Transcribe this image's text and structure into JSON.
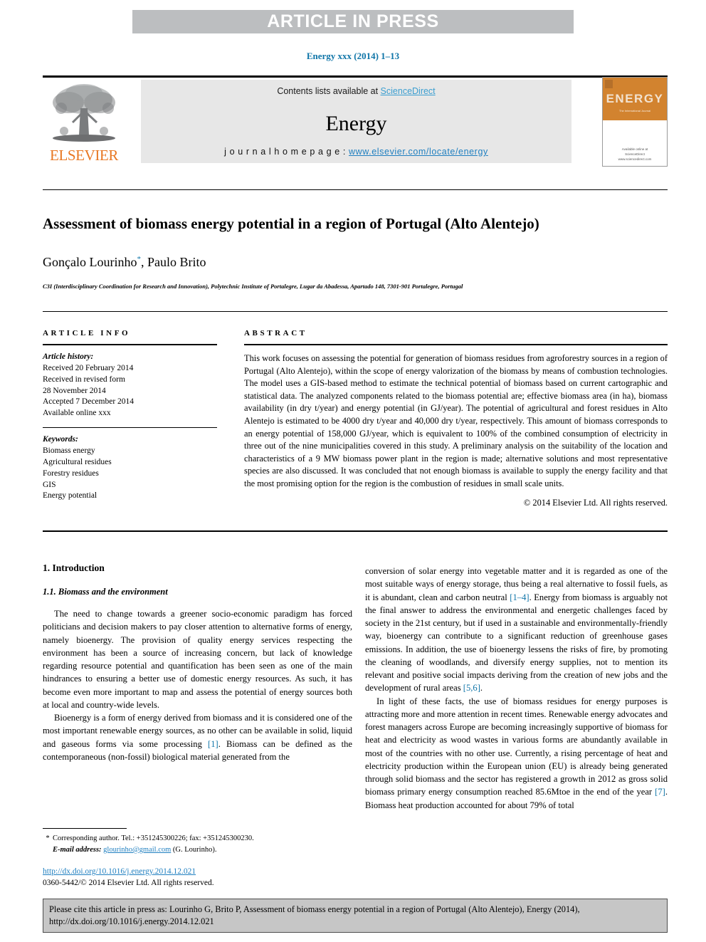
{
  "banner": {
    "text": "ARTICLE IN PRESS"
  },
  "running_head": {
    "text": "Energy xxx (2014) 1–13"
  },
  "masthead": {
    "contents_prefix": "Contents lists available at ",
    "sciencedirect": "ScienceDirect",
    "journal_title": "Energy",
    "homepage_prefix": "j o u r n a l   h o m e p a g e :  ",
    "homepage_url": "www.elsevier.com/locate/energy",
    "publisher": "ELSEVIER",
    "cover": {
      "title": "ENERGY",
      "subtitle": "The International Journal",
      "footer_line1": "Available online at",
      "footer_line2": "ScienceDirect",
      "footer_line3": "www.sciencedirect.com"
    }
  },
  "article": {
    "title": "Assessment of biomass energy potential in a region of Portugal (Alto Alentejo)",
    "authors": "Gonçalo Lourinho",
    "authors_rest": ", Paulo Brito",
    "corresponding_marker": "*",
    "affiliation": "C3I (Interdisciplinary Coordination for Research and Innovation), Polytechnic Institute of Portalegre, Lugar da Abadessa, Apartado 148, 7301-901 Portalegre, Portugal"
  },
  "article_info": {
    "heading": "ARTICLE INFO",
    "history_label": "Article history:",
    "history": [
      "Received 20 February 2014",
      "Received in revised form",
      "28 November 2014",
      "Accepted 7 December 2014",
      "Available online xxx"
    ],
    "keywords_label": "Keywords:",
    "keywords": [
      "Biomass energy",
      "Agricultural residues",
      "Forestry residues",
      "GIS",
      "Energy potential"
    ]
  },
  "abstract": {
    "heading": "ABSTRACT",
    "text": "This work focuses on assessing the potential for generation of biomass residues from agroforestry sources in a region of Portugal (Alto Alentejo), within the scope of energy valorization of the biomass by means of combustion technologies. The model uses a GIS-based method to estimate the technical potential of biomass based on current cartographic and statistical data. The analyzed components related to the biomass potential are; effective biomass area (in ha), biomass availability (in dry t/year) and energy potential (in GJ/year). The potential of agricultural and forest residues in Alto Alentejo is estimated to be 4000 dry t/year and 40,000 dry t/year, respectively. This amount of biomass corresponds to an energy potential of 158,000 GJ/year, which is equivalent to 100% of the combined consumption of electricity in three out of the nine municipalities covered in this study. A preliminary analysis on the suitability of the location and characteristics of a 9 MW biomass power plant in the region is made; alternative solutions and most representative species are also discussed. It was concluded that not enough biomass is available to supply the energy facility and that the most promising option for the region is the combustion of residues in small scale units.",
    "copyright": "© 2014 Elsevier Ltd. All rights reserved."
  },
  "body": {
    "section_number_title": "1. Introduction",
    "subsection_number_title": "1.1. Biomass and the environment",
    "left_paragraphs": [
      "The need to change towards a greener socio-economic paradigm has forced politicians and decision makers to pay closer attention to alternative forms of energy, namely bioenergy. The provision of quality energy services respecting the environment has been a source of increasing concern, but lack of knowledge regarding resource potential and quantification has been seen as one of the main hindrances to ensuring a better use of domestic energy resources. As such, it has become even more important to map and assess the potential of energy sources both at local and country-wide levels."
    ],
    "left_para2_a": "Bioenergy is a form of energy derived from biomass and it is considered one of the most important renewable energy sources, as no other can be available in solid, liquid and gaseous forms via some processing ",
    "left_para2_ref": "[1]",
    "left_para2_b": ". Biomass can be defined as the contemporaneous (non-fossil) biological material generated from the",
    "right_para1_a": "conversion of solar energy into vegetable matter and it is regarded as one of the most suitable ways of energy storage, thus being a real alternative to fossil fuels, as it is abundant, clean and carbon neutral ",
    "right_para1_ref": "[1–4]",
    "right_para1_b": ". Energy from biomass is arguably not the final answer to address the environmental and energetic challenges faced by society in the 21st century, but if used in a sustainable and environmentally-friendly way, bioenergy can contribute to a significant reduction of greenhouse gases emissions. In addition, the use of bioenergy lessens the risks of fire, by promoting the cleaning of woodlands, and diversify energy supplies, not to mention its relevant and positive social impacts deriving from the creation of new jobs and the development of rural areas ",
    "right_para1_ref2": "[5,6]",
    "right_para1_c": ".",
    "right_para2_a": "In light of these facts, the use of biomass residues for energy purposes is attracting more and more attention in recent times. Renewable energy advocates and forest managers across Europe are becoming increasingly supportive of biomass for heat and electricity as wood wastes in various forms are abundantly available in most of the countries with no other use. Currently, a rising percentage of heat and electricity production within the European union (EU) is already being generated through solid biomass and the sector has registered a growth in 2012 as gross solid biomass primary energy consumption reached 85.6Mtoe in the end of the year ",
    "right_para2_ref": "[7]",
    "right_para2_b": ". Biomass heat production accounted for about 79% of total"
  },
  "footnote": {
    "star": "*",
    "corresponding": "Corresponding author. Tel.: +351245300226; fax: +351245300230.",
    "email_label": "E-mail address:",
    "email": "glourinho@gmail.com",
    "email_owner": "(G. Lourinho)."
  },
  "doi": {
    "url": "http://dx.doi.org/10.1016/j.energy.2014.12.021",
    "issn_line": "0360-5442/© 2014 Elsevier Ltd. All rights reserved."
  },
  "cite_box": {
    "text": "Please cite this article in press as: Lourinho G, Brito P, Assessment of biomass energy potential in a region of Portugal (Alto Alentejo), Energy (2014), http://dx.doi.org/10.1016/j.energy.2014.12.021"
  },
  "colors": {
    "link_blue": "#1f7fc0",
    "header_blue": "#0f75a8",
    "banner_gray": "#bcbec0",
    "band_gray": "#e7e7e7",
    "elsevier_orange": "#e87722",
    "cover_orange": "#d2832f",
    "cite_gray": "#c6c6c6"
  }
}
